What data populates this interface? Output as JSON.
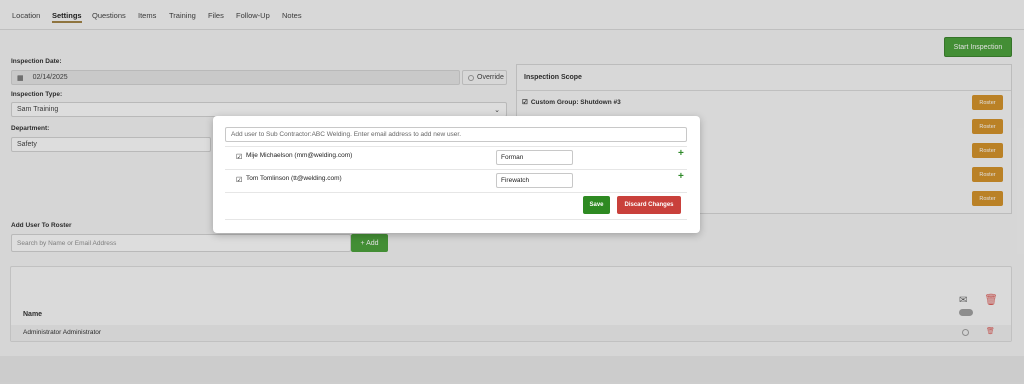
{
  "tabs": [
    "Location",
    "Settings",
    "Questions",
    "Items",
    "Training",
    "Files",
    "Follow-Up",
    "Notes"
  ],
  "active_tab": "Settings",
  "start_inspection_label": "Start Inspection",
  "inspection_date": {
    "label": "Inspection Date:",
    "value": "02/14/2025",
    "override_label": "Override"
  },
  "inspection_type": {
    "label": "Inspection Type:",
    "value": "Sam Training"
  },
  "department": {
    "label": "Department:",
    "value": "Safety"
  },
  "scope": {
    "title": "Inspection Scope",
    "group_label": "Custom Group: Shutdown #3",
    "roster_label": "Roster"
  },
  "add_user": {
    "label": "Add User To Roster",
    "placeholder": "Search by Name or Email Address",
    "button": "+ Add"
  },
  "table": {
    "col_name": "Name",
    "row": "Administrator Administrator"
  },
  "modal": {
    "placeholder": "Add user to Sub Contractor:ABC Welding. Enter email address to add new user.",
    "rows": [
      {
        "name": "Mije Michaelson (mm@welding.com)",
        "role": "Forman"
      },
      {
        "name": "Tom Tomlinson (tt@welding.com)",
        "role": "Firewatch"
      }
    ],
    "save": "Save",
    "discard": "Discard Changes"
  },
  "colors": {
    "green": "#3f9a2e",
    "orange": "#d08a1c",
    "red": "#c9403b"
  }
}
